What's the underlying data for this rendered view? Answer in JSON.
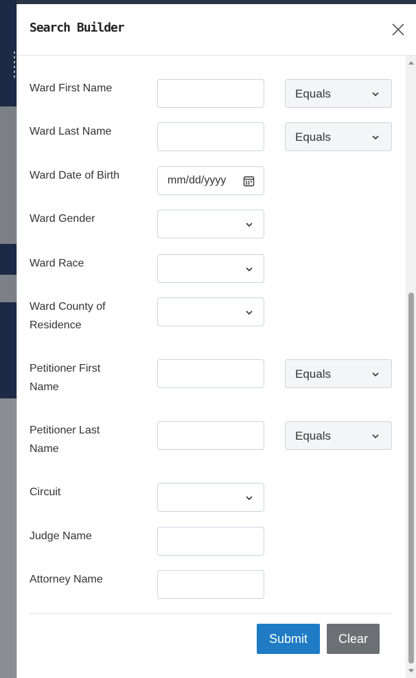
{
  "modal": {
    "title": "Search Builder",
    "close_label": "×"
  },
  "fields": [
    {
      "label": "Ward First Name",
      "type": "text",
      "value": "",
      "operator": "Equals"
    },
    {
      "label": "Ward Last Name",
      "type": "text",
      "value": "",
      "operator": "Equals"
    },
    {
      "label": "Ward Date of Birth",
      "type": "date",
      "value": "mm/dd/yyyy"
    },
    {
      "label": "Ward Gender",
      "type": "select",
      "value": ""
    },
    {
      "label": "Ward Race",
      "type": "select",
      "value": ""
    },
    {
      "label": "Ward County of Residence",
      "type": "select",
      "value": ""
    },
    {
      "label": "Petitioner First Name",
      "type": "text",
      "value": "",
      "operator": "Equals"
    },
    {
      "label": "Petitioner Last Name",
      "type": "text",
      "value": "",
      "operator": "Equals"
    },
    {
      "label": "Circuit",
      "type": "select",
      "value": ""
    },
    {
      "label": "Judge Name",
      "type": "text",
      "value": ""
    },
    {
      "label": "Attorney Name",
      "type": "text",
      "value": ""
    }
  ],
  "buttons": {
    "submit": "Submit",
    "clear": "Clear"
  },
  "colors": {
    "submit": "#1e7bc4",
    "clear": "#6c6f73"
  }
}
